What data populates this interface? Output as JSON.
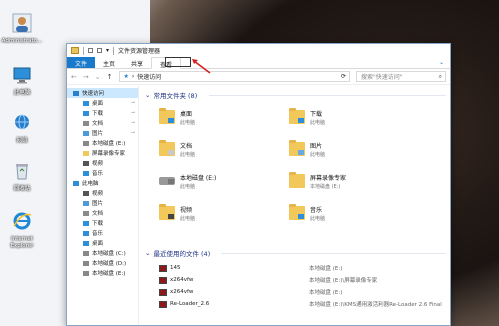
{
  "desktop": {
    "icons": [
      {
        "label": "Administrato...",
        "icon": "user-icon"
      },
      {
        "label": "此电脑",
        "icon": "computer-icon"
      },
      {
        "label": "网络",
        "icon": "network-icon"
      },
      {
        "label": "回收站",
        "icon": "recycle-bin-icon"
      },
      {
        "label": "Internet Explorer",
        "icon": "ie-icon"
      }
    ]
  },
  "window": {
    "title": "文件资源管理器",
    "ribbon_tabs": [
      "文件",
      "主页",
      "共享",
      "查看"
    ],
    "address": {
      "back": "←",
      "forward": "→",
      "up": "↑",
      "path": "快速访问",
      "search_placeholder": "搜索\"快速访问\""
    },
    "nav_pane": [
      {
        "label": "快速访问",
        "level": 0,
        "selected": true,
        "icon": "star-icon"
      },
      {
        "label": "桌面",
        "level": 1,
        "pinned": true,
        "icon": "desktop-folder-icon"
      },
      {
        "label": "下载",
        "level": 1,
        "pinned": true,
        "icon": "download-icon"
      },
      {
        "label": "文档",
        "level": 1,
        "pinned": true,
        "icon": "document-icon"
      },
      {
        "label": "图片",
        "level": 1,
        "pinned": true,
        "icon": "picture-icon"
      },
      {
        "label": "本地磁盘 (E:)",
        "level": 1,
        "icon": "drive-icon"
      },
      {
        "label": "屏幕录像专家",
        "level": 1,
        "icon": "folder-icon"
      },
      {
        "label": "视频",
        "level": 1,
        "icon": "video-icon"
      },
      {
        "label": "音乐",
        "level": 1,
        "icon": "music-icon"
      },
      {
        "label": "此电脑",
        "level": 0,
        "icon": "computer-icon"
      },
      {
        "label": "视频",
        "level": 1,
        "icon": "video-icon"
      },
      {
        "label": "图片",
        "level": 1,
        "icon": "picture-icon"
      },
      {
        "label": "文档",
        "level": 1,
        "icon": "document-icon"
      },
      {
        "label": "下载",
        "level": 1,
        "icon": "download-icon"
      },
      {
        "label": "音乐",
        "level": 1,
        "icon": "music-icon"
      },
      {
        "label": "桌面",
        "level": 1,
        "icon": "desktop-folder-icon"
      },
      {
        "label": "本地磁盘 (C:)",
        "level": 1,
        "icon": "drive-icon"
      },
      {
        "label": "本地磁盘 (D:)",
        "level": 1,
        "icon": "drive-icon"
      },
      {
        "label": "本地磁盘 (E:)",
        "level": 1,
        "icon": "drive-icon"
      }
    ],
    "frequent": {
      "header": "常用文件夹 (8)",
      "items": [
        {
          "name": "桌面",
          "sub": "此电脑",
          "icon": "desktop-folder-icon"
        },
        {
          "name": "下载",
          "sub": "此电脑",
          "icon": "download-icon"
        },
        {
          "name": "文档",
          "sub": "此电脑",
          "icon": "document-icon"
        },
        {
          "name": "图片",
          "sub": "此电脑",
          "icon": "picture-icon"
        },
        {
          "name": "本地磁盘 (E:)",
          "sub": "此电脑",
          "icon": "drive-icon"
        },
        {
          "name": "屏幕录像专家",
          "sub": "本地磁盘 (E:)",
          "icon": "folder-icon"
        },
        {
          "name": "视频",
          "sub": "此电脑",
          "icon": "video-icon"
        },
        {
          "name": "音乐",
          "sub": "此电脑",
          "icon": "music-icon"
        }
      ]
    },
    "recent": {
      "header": "最近使用的文件 (4)",
      "items": [
        {
          "name": "145",
          "path": "本地磁盘 (E:)"
        },
        {
          "name": "x264vfw",
          "path": "本地磁盘 (E:)\\屏幕录像专家"
        },
        {
          "name": "x264vfw",
          "path": "本地磁盘 (E:)"
        },
        {
          "name": "Re-Loader_2.6",
          "path": "本地磁盘 (E:)\\KMS通用激活利器Re-Loader 2.6 Final"
        }
      ]
    }
  }
}
